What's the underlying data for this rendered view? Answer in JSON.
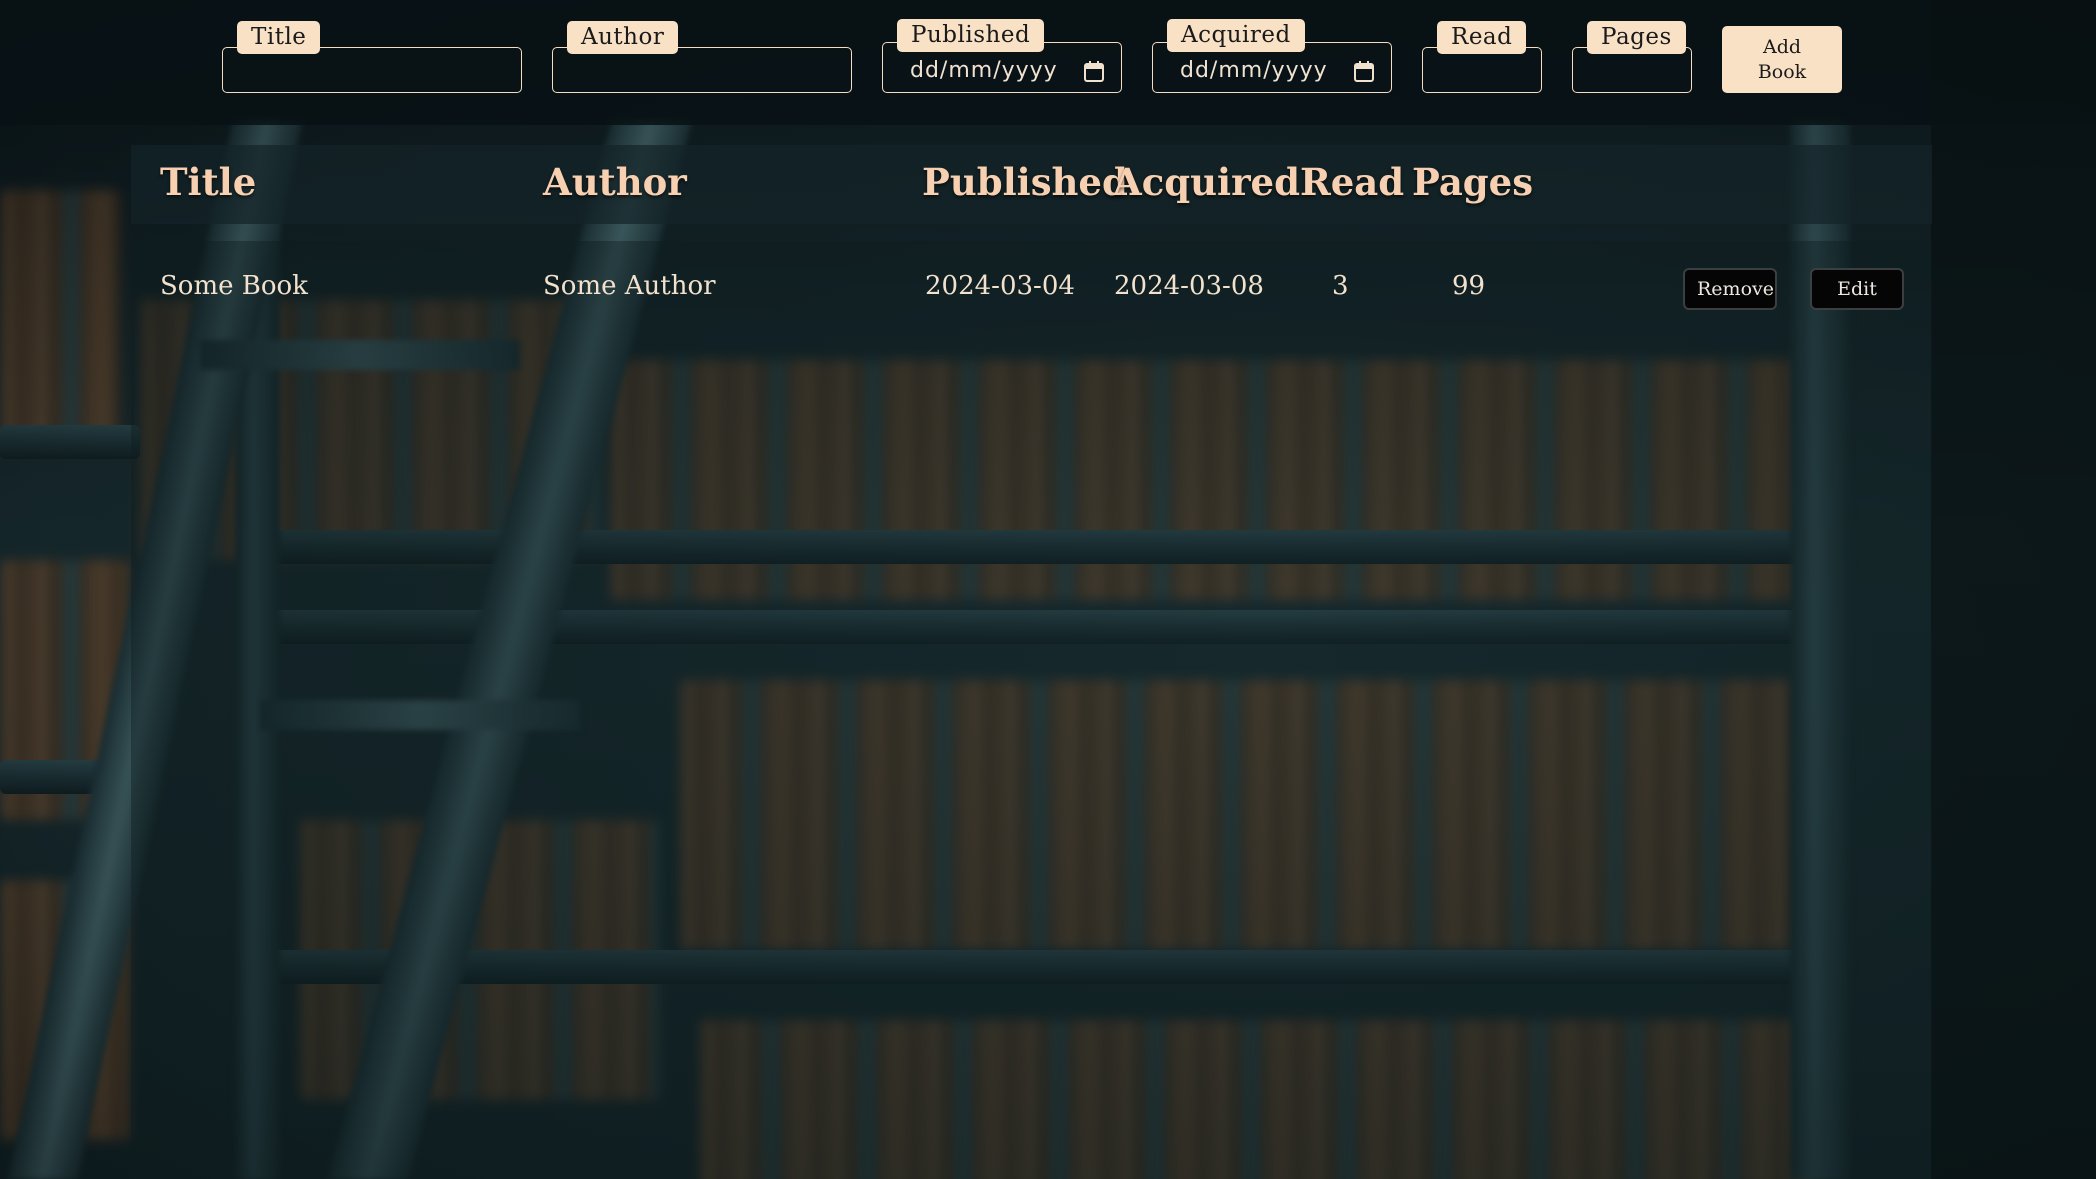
{
  "form": {
    "fields": [
      {
        "label": "Title",
        "type": "text",
        "value": ""
      },
      {
        "label": "Author",
        "type": "text",
        "value": ""
      },
      {
        "label": "Published",
        "type": "date",
        "placeholder": "dd/mm/yyyy"
      },
      {
        "label": "Acquired",
        "type": "date",
        "placeholder": "dd/mm/yyyy"
      },
      {
        "label": "Read",
        "type": "number",
        "value": ""
      },
      {
        "label": "Pages",
        "type": "number",
        "value": ""
      }
    ],
    "add_button": "Add\nBook",
    "calendar_icon": "calendar-icon"
  },
  "table": {
    "headers": [
      "Title",
      "Author",
      "Published",
      "Acquired",
      "Read",
      "Pages"
    ],
    "rows": [
      {
        "title": "Some Book",
        "author": "Some Author",
        "published": "2024-03-04",
        "acquired": "2024-03-08",
        "read": "3",
        "pages": "99",
        "remove_label": "Remove",
        "edit_label": "Edit"
      }
    ]
  },
  "colors": {
    "accent_cream": "#f9e1c6",
    "header_text": "#f7cfb1",
    "body_text": "#f1e1cd",
    "button_dark": "#050505"
  }
}
